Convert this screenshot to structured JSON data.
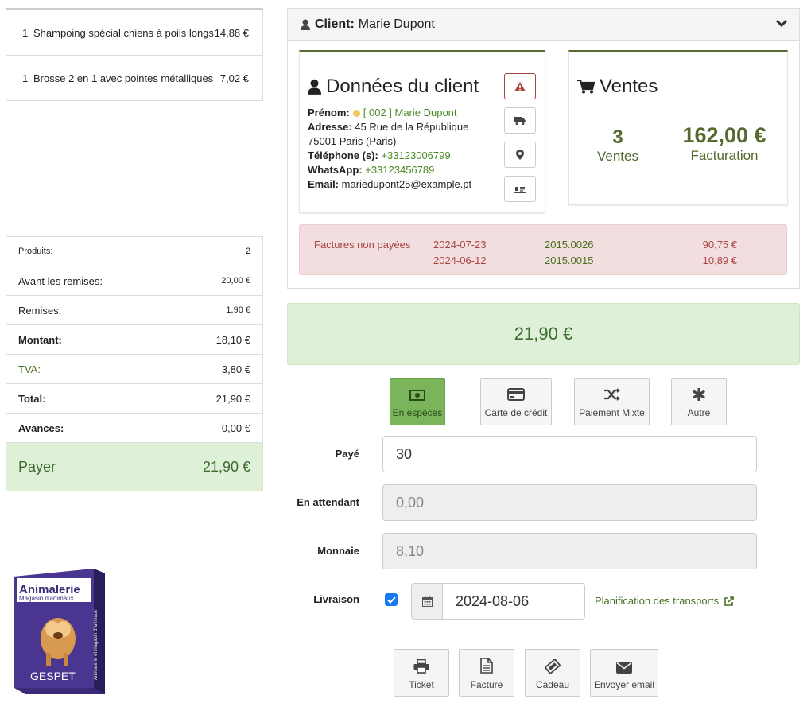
{
  "cart": {
    "items": [
      {
        "qty": "1",
        "name": "Shampoing spécial chiens à poils longs",
        "price": "14,88 €"
      },
      {
        "qty": "1",
        "name": "Brosse 2 en 1 avec pointes métalliques",
        "price": "7,02 €"
      }
    ]
  },
  "totals": {
    "produits_label": "Produits:",
    "produits_value": "2",
    "avant_label": "Avant les remises:",
    "avant_value": "20,00 €",
    "remises_label": "Remises:",
    "remises_value": "1,90 €",
    "montant_label": "Montant:",
    "montant_value": "18,10 €",
    "tva_label": "TVA:",
    "tva_value": "3,80 €",
    "total_label": "Total:",
    "total_value": "21,90 €",
    "avances_label": "Avances:",
    "avances_value": "0,00 €",
    "payer_label": "Payer",
    "payer_value": "21,90 €"
  },
  "product_box": {
    "title": "Animalerie",
    "subtitle": "Magasin d'animaux",
    "brand": "GESPET",
    "side_text": "Animalerie et magasin d'animaux",
    "top_side": "GESPET"
  },
  "client": {
    "header_label": "Client:",
    "header_name": "Marie Dupont",
    "card_title": "Données du client",
    "prenom_label": "Prénom:",
    "prenom_value": "[ 002 ] Marie Dupont",
    "adresse_label": "Adresse:",
    "adresse_line1": "45 Rue de la République",
    "adresse_line2": "75001 Paris (Paris)",
    "tel_label": "Téléphone (s):",
    "tel_value": "+33123006799",
    "whatsapp_label": "WhatsApp:",
    "whatsapp_value": "+33123456789",
    "email_label": "Email:",
    "email_value": "mariedupont25@example.pt"
  },
  "sales": {
    "title": "Ventes",
    "count": "3",
    "count_label": "Ventes",
    "amount": "162,00 €",
    "amount_label": "Facturation"
  },
  "unpaid": {
    "label": "Factures non payées",
    "rows": [
      {
        "date": "2024-07-23",
        "number": "2015.0026",
        "amount": "90,75 €"
      },
      {
        "date": "2024-06-12",
        "number": "2015.0015",
        "amount": "10,89 €"
      }
    ]
  },
  "big_total": "21,90 €",
  "payment_methods": [
    "En espèces",
    "Carte de crédit",
    "Paiement Mixte",
    "Autre"
  ],
  "form": {
    "paye_label": "Payé",
    "paye_value": "30",
    "attente_label": "En attendant",
    "attente_value": "0,00",
    "monnaie_label": "Monnaie",
    "monnaie_value": "8,10",
    "livraison_label": "Livraison",
    "livraison_date": "2024-08-06",
    "transport_link": "Planification des transports"
  },
  "actions": [
    "Ticket",
    "Facture",
    "Cadeau",
    "Envoyer email"
  ],
  "colors": {
    "accent_green": "#4a7023",
    "success_bg": "#dff0d8",
    "danger_bg": "#f2dede",
    "active_pm": "#7ab55c"
  }
}
